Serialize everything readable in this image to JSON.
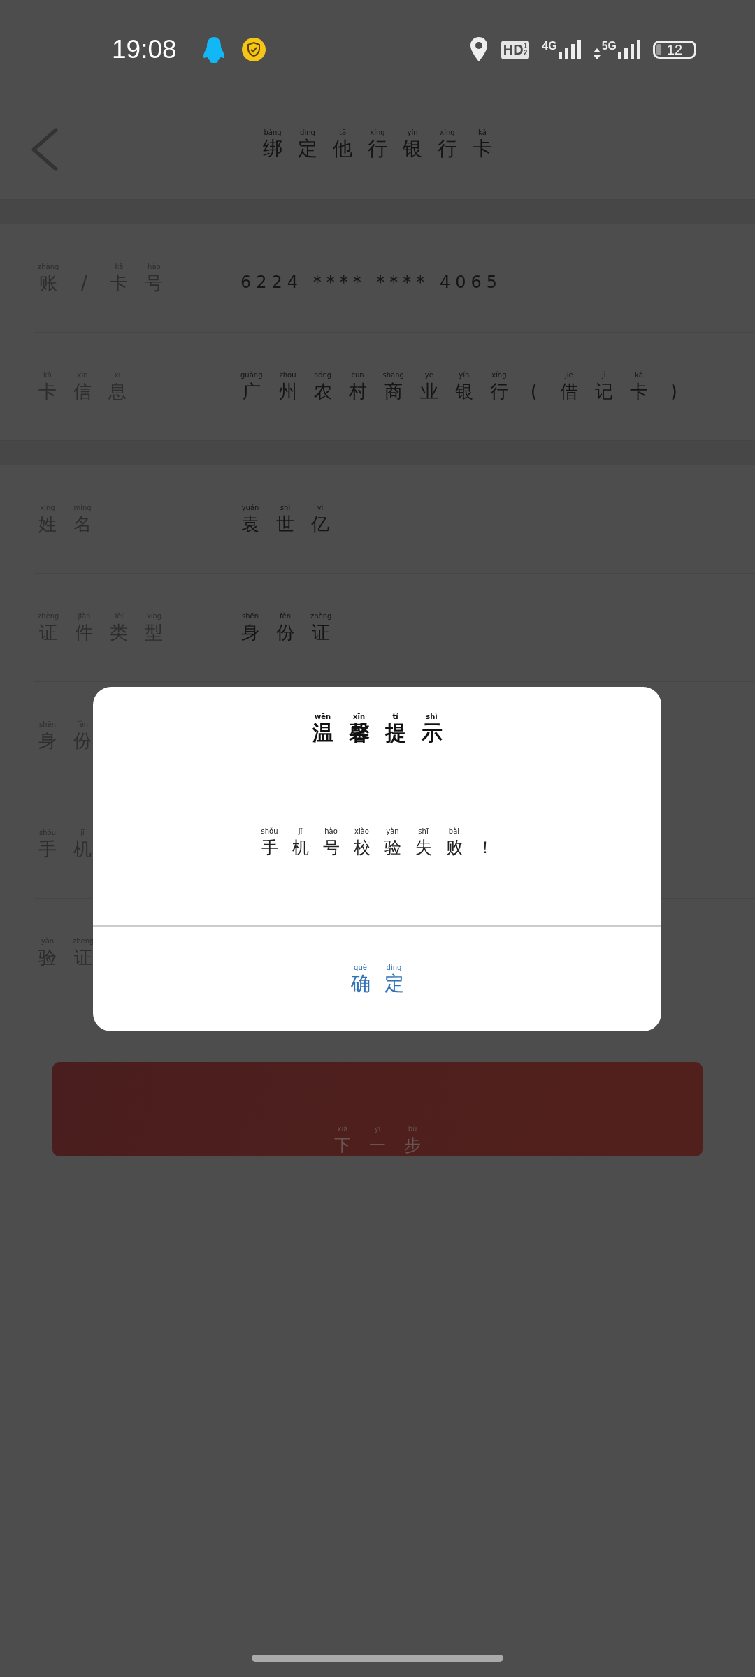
{
  "status_bar": {
    "time": "19:08",
    "hd": "HD",
    "hd_sub": [
      "1",
      "2"
    ],
    "networks": [
      "4G",
      "5G"
    ],
    "battery": "12"
  },
  "header": {
    "title": [
      {
        "c": "绑",
        "py": "bǎng"
      },
      {
        "c": "定",
        "py": "dìng"
      },
      {
        "c": "他",
        "py": "tā"
      },
      {
        "c": "行",
        "py": "xíng"
      },
      {
        "c": "银",
        "py": "yín"
      },
      {
        "c": "行",
        "py": "xíng"
      },
      {
        "c": "卡",
        "py": "kǎ"
      }
    ]
  },
  "sections": [
    {
      "rows": [
        {
          "label": [
            {
              "c": "账",
              "py": "zhàng"
            },
            {
              "c": "/"
            },
            {
              "c": "卡",
              "py": "kǎ"
            },
            {
              "c": "号",
              "py": "hào"
            }
          ],
          "value_plain": "6224 **** **** 4065"
        },
        {
          "label": [
            {
              "c": "卡",
              "py": "kǎ"
            },
            {
              "c": "信",
              "py": "xìn"
            },
            {
              "c": "息",
              "py": "xī"
            }
          ],
          "value": [
            {
              "c": "广",
              "py": "guǎng"
            },
            {
              "c": "州",
              "py": "zhōu"
            },
            {
              "c": "农",
              "py": "nóng"
            },
            {
              "c": "村",
              "py": "cūn"
            },
            {
              "c": "商",
              "py": "shāng"
            },
            {
              "c": "业",
              "py": "yè"
            },
            {
              "c": "银",
              "py": "yín"
            },
            {
              "c": "行",
              "py": "xíng"
            },
            {
              "c": "("
            },
            {
              "c": "借",
              "py": "jiè"
            },
            {
              "c": "记",
              "py": "jì"
            },
            {
              "c": "卡",
              "py": "kǎ"
            },
            {
              "c": ")"
            }
          ]
        }
      ]
    },
    {
      "rows": [
        {
          "label": [
            {
              "c": "姓",
              "py": "xìng"
            },
            {
              "c": "名",
              "py": "míng"
            }
          ],
          "value": [
            {
              "c": "袁",
              "py": "yuán"
            },
            {
              "c": "世",
              "py": "shì"
            },
            {
              "c": "亿",
              "py": "yì"
            }
          ]
        },
        {
          "label": [
            {
              "c": "证",
              "py": "zhèng"
            },
            {
              "c": "件",
              "py": "jiàn"
            },
            {
              "c": "类",
              "py": "lèi"
            },
            {
              "c": "型",
              "py": "xíng"
            }
          ],
          "value": [
            {
              "c": "身",
              "py": "shēn"
            },
            {
              "c": "份",
              "py": "fèn"
            },
            {
              "c": "证",
              "py": "zhèng"
            }
          ]
        },
        {
          "label": [
            {
              "c": "身",
              "py": "shēn"
            },
            {
              "c": "份",
              "py": "fèn"
            }
          ]
        },
        {
          "label": [
            {
              "c": "手",
              "py": "shǒu"
            },
            {
              "c": "机",
              "py": "jī"
            }
          ]
        },
        {
          "label": [
            {
              "c": "验",
              "py": "yàn"
            },
            {
              "c": "证",
              "py": "zhèng"
            }
          ]
        }
      ]
    }
  ],
  "next_button": [
    {
      "c": "下",
      "py": "xià"
    },
    {
      "c": "一",
      "py": "yī"
    },
    {
      "c": "步",
      "py": "bù"
    }
  ],
  "dialog": {
    "title": [
      {
        "c": "温",
        "py": "wēn"
      },
      {
        "c": "馨",
        "py": "xīn"
      },
      {
        "c": "提",
        "py": "tí"
      },
      {
        "c": "示",
        "py": "shì"
      }
    ],
    "message": [
      {
        "c": "手",
        "py": "shǒu"
      },
      {
        "c": "机",
        "py": "jī"
      },
      {
        "c": "号",
        "py": "hào"
      },
      {
        "c": "校",
        "py": "xiào"
      },
      {
        "c": "验",
        "py": "yàn"
      },
      {
        "c": "失",
        "py": "shī"
      },
      {
        "c": "败",
        "py": "bài"
      },
      {
        "c": "！"
      }
    ],
    "confirm": [
      {
        "c": "确",
        "py": "què"
      },
      {
        "c": "定",
        "py": "dìng"
      }
    ]
  }
}
